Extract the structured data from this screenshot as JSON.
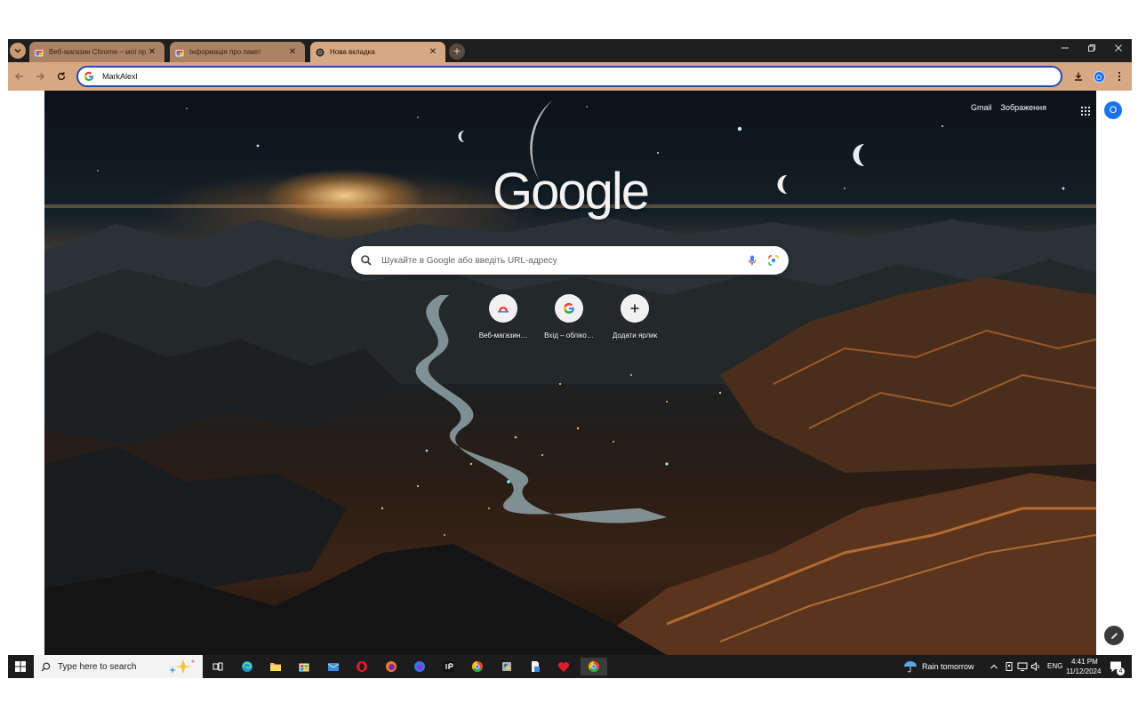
{
  "browser": {
    "tabs": [
      {
        "title": "Веб-магазин Chrome – мої пр…",
        "active": false,
        "favicon": "chrome-webstore-icon"
      },
      {
        "title": "Інформація про пакет",
        "active": false,
        "favicon": "chrome-webstore-icon"
      },
      {
        "title": "Нова вкладка",
        "active": true,
        "favicon": "chrome-icon"
      }
    ],
    "new_tab_label": "+",
    "omnibox_value": "MarkAlexl",
    "profile_initial": "O"
  },
  "ntp": {
    "links": {
      "gmail": "Gmail",
      "images": "Зображення"
    },
    "profile_initial": "O",
    "logo_text": "Google",
    "search_placeholder": "Шукайте в Google або введіть URL-адресу",
    "shortcuts": [
      {
        "label": "Веб-магазин…",
        "icon": "chrome-webstore-icon"
      },
      {
        "label": "Вхід – облікo…",
        "icon": "google-g-icon"
      },
      {
        "label": "Додати ярлик",
        "icon": "plus-icon"
      }
    ]
  },
  "taskbar": {
    "search_placeholder": "Type here to search",
    "weather": "Rain tomorrow",
    "language": "ENG",
    "time": "4:41 PM",
    "date": "11/12/2024",
    "notifications": "4"
  },
  "colors": {
    "frame": "#d8a882",
    "tabstrip": "#1f1f1f",
    "accent": "#1a73e8"
  }
}
